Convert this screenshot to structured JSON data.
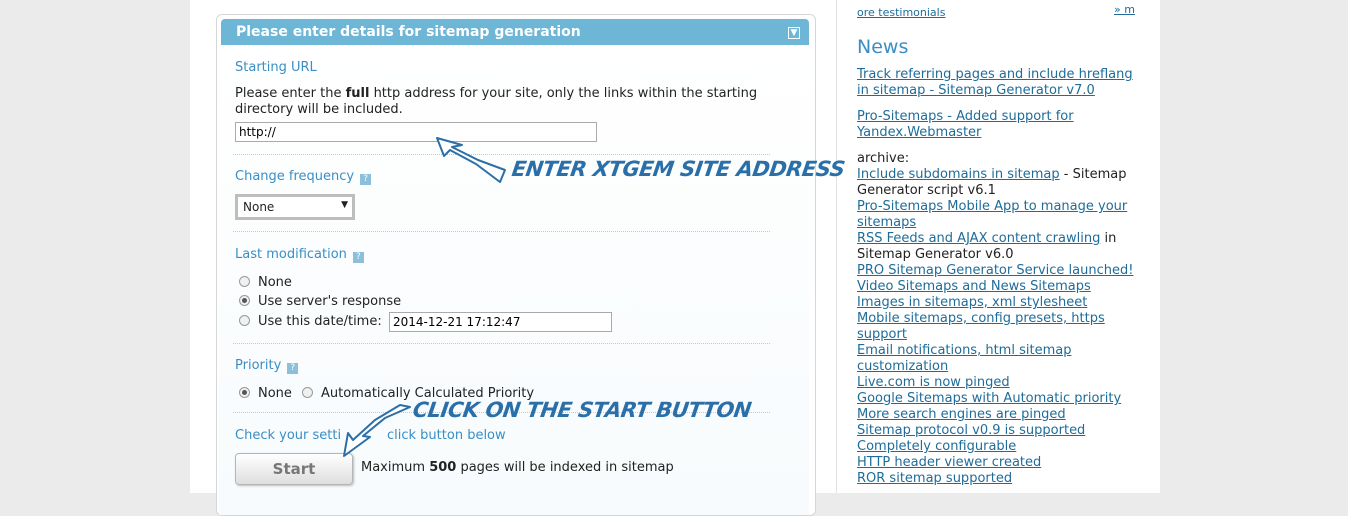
{
  "panel": {
    "title": "Please enter details for sitemap generation",
    "collapse_icon": "arrow-down-icon"
  },
  "starting_url": {
    "title": "Starting URL",
    "desc_before": "Please enter the ",
    "desc_bold": "full",
    "desc_after": " http address for your site, only the links within the starting directory will be included.",
    "value": "http://"
  },
  "change_frequency": {
    "title": "Change frequency",
    "help": "?",
    "selected": "None"
  },
  "last_modification": {
    "title": "Last modification",
    "help": "?",
    "options": [
      "None",
      "Use server's response",
      "Use this date/time:"
    ],
    "selected_index": 1,
    "date_value": "2014-12-21 17:12:47"
  },
  "priority": {
    "title": "Priority",
    "help": "?",
    "options": [
      "None",
      "Automatically Calculated Priority"
    ],
    "selected_index": 0
  },
  "check": {
    "title_part1": "Check your setti",
    "title_part2": "click button below",
    "start_label": "Start",
    "max_before": "Maximum ",
    "max_value": "500",
    "max_after": " pages will be indexed in sitemap"
  },
  "annotations": {
    "enter_site": "Enter XTGEM Site Address",
    "click_start": "Click on the Start Button"
  },
  "sidebar": {
    "testimonials": "ore testimonials",
    "more": "» m",
    "news_title": "News",
    "news": [
      "Track referring pages and include hreflang in sitemap - Sitemap Generator v7.0",
      "Pro-Sitemaps - Added support for Yandex.Webmaster"
    ],
    "archive_label": "archive:",
    "archive": [
      {
        "link": "Include subdomains in sitemap",
        "suffix": " - Sitemap Generator script v6.1"
      },
      {
        "link": "Pro-Sitemaps Mobile App to manage your sitemaps",
        "suffix": ""
      },
      {
        "link": "RSS Feeds and AJAX content crawling",
        "suffix": " in Sitemap Generator v6.0"
      },
      {
        "link": "PRO Sitemap Generator Service launched!",
        "suffix": ""
      },
      {
        "link": "Video Sitemaps and News Sitemaps",
        "suffix": ""
      },
      {
        "link": "Images in sitemaps, xml stylesheet",
        "suffix": ""
      },
      {
        "link": "Mobile sitemaps, config presets, https support",
        "suffix": ""
      },
      {
        "link": "Email notifications, html sitemap customization",
        "suffix": ""
      },
      {
        "link": "Live.com is now pinged",
        "suffix": ""
      },
      {
        "link": "Google Sitemaps with Automatic priority",
        "suffix": ""
      },
      {
        "link": "More search engines are pinged",
        "suffix": ""
      },
      {
        "link": "Sitemap protocol v0.9 is supported",
        "suffix": ""
      },
      {
        "link": "Completely configurable",
        "suffix": ""
      },
      {
        "link": "HTTP header viewer created",
        "suffix": ""
      },
      {
        "link": "ROR sitemap supported",
        "suffix": ""
      }
    ]
  }
}
